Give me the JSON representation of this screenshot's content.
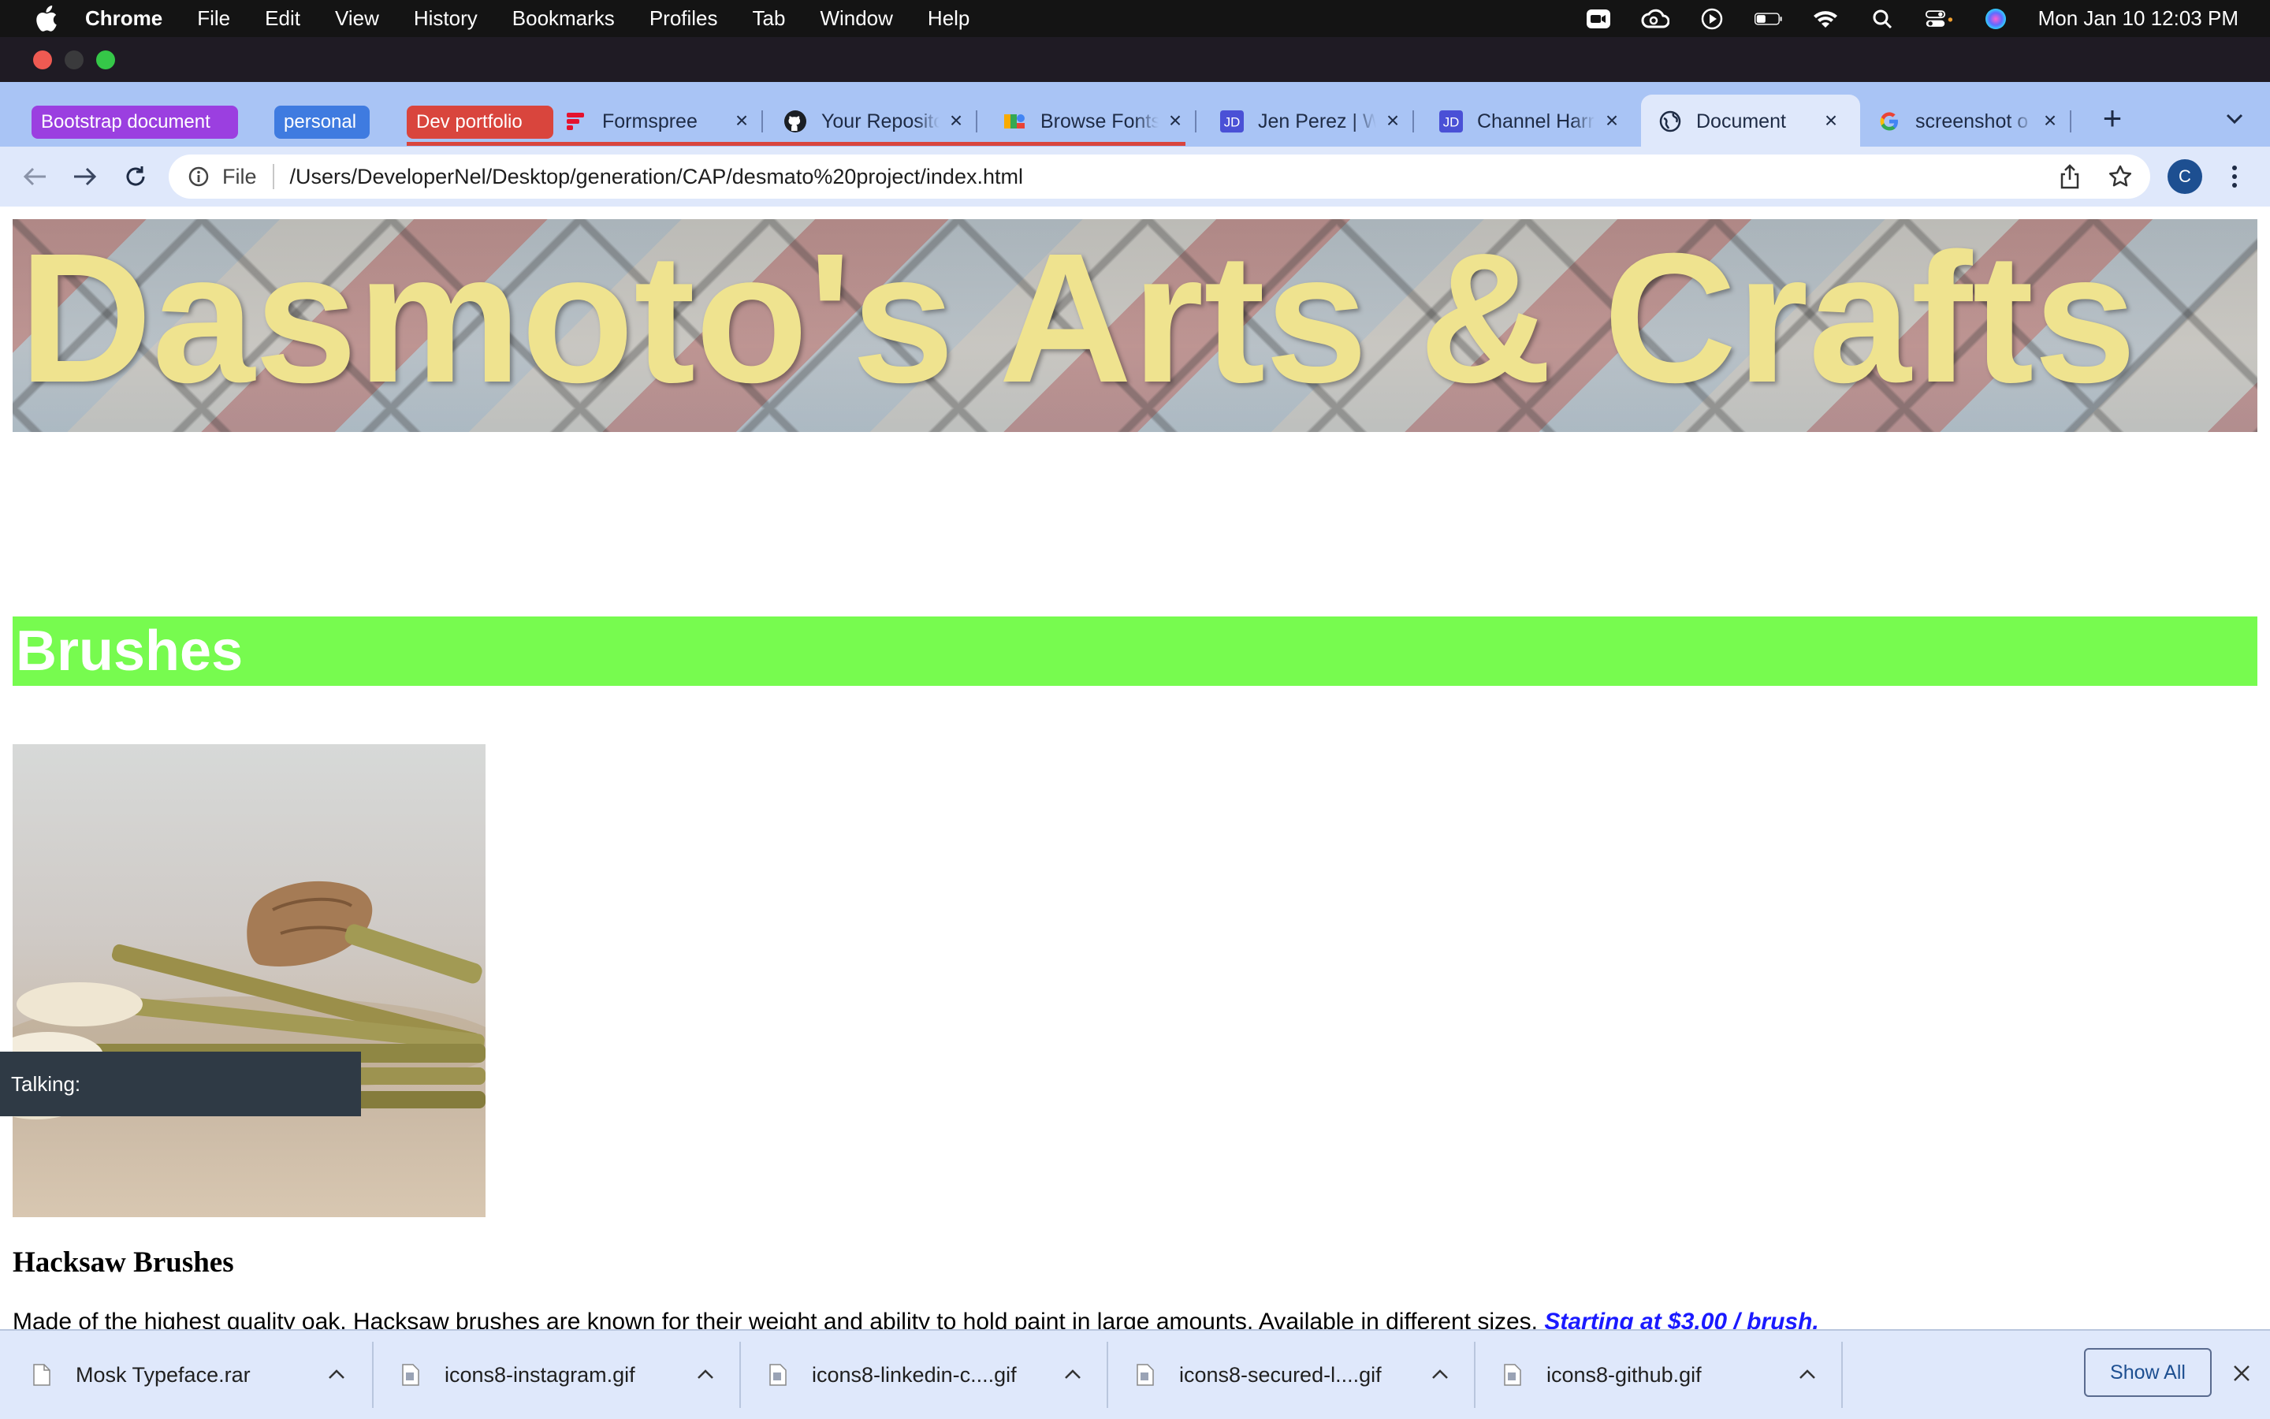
{
  "menubar": {
    "app_name": "Chrome",
    "items": [
      "File",
      "Edit",
      "View",
      "History",
      "Bookmarks",
      "Profiles",
      "Tab",
      "Window",
      "Help"
    ],
    "clock": "Mon Jan 10  12:03 PM",
    "status_icons": [
      "video-icon",
      "creative-cloud-icon",
      "play-icon",
      "battery-icon",
      "wifi-icon",
      "search-icon",
      "control-center-icon",
      "siri-icon"
    ]
  },
  "tab_groups": [
    {
      "label": "Bootstrap document",
      "color": "#9b3fe0"
    },
    {
      "label": "personal",
      "color": "#3f7be0"
    },
    {
      "label": "Dev portfolio",
      "color": "#d9453d"
    }
  ],
  "tabs": [
    {
      "title": "Formspree",
      "icon": "formspree-icon"
    },
    {
      "title": "Your Reposito",
      "icon": "github-icon"
    },
    {
      "title": "Browse Fonts",
      "icon": "google-fonts-icon"
    },
    {
      "title": "Jen Perez | W",
      "icon": "jd-icon"
    },
    {
      "title": "Channel Harr",
      "icon": "jd-icon"
    },
    {
      "title": "Document",
      "icon": "globe-icon",
      "active": true
    },
    {
      "title": "screenshot o",
      "icon": "google-icon"
    }
  ],
  "toolbar": {
    "scheme": "File",
    "url": "/Users/DeveloperNel/Desktop/generation/CAP/desmato%20project/index.html",
    "avatar_letter": "C"
  },
  "page": {
    "title": "Dasmoto's Arts & Crafts",
    "section_heading": "Brushes",
    "section_color": "#77fb4f",
    "title_color": "#efe38f",
    "tooltip": "Talking:",
    "product_name": "Hacksaw Brushes",
    "product_desc": "Made of the highest quality oak, Hacksaw brushes are known for their weight and ability to hold paint in large amounts. Available in different sizes.",
    "product_price": "Starting at $3.00 / brush."
  },
  "downloads": [
    {
      "name": "Mosk Typeface.rar"
    },
    {
      "name": "icons8-instagram.gif"
    },
    {
      "name": "icons8-linkedin-c....gif"
    },
    {
      "name": "icons8-secured-l....gif"
    },
    {
      "name": "icons8-github.gif"
    }
  ],
  "shelf": {
    "show_all": "Show All"
  }
}
